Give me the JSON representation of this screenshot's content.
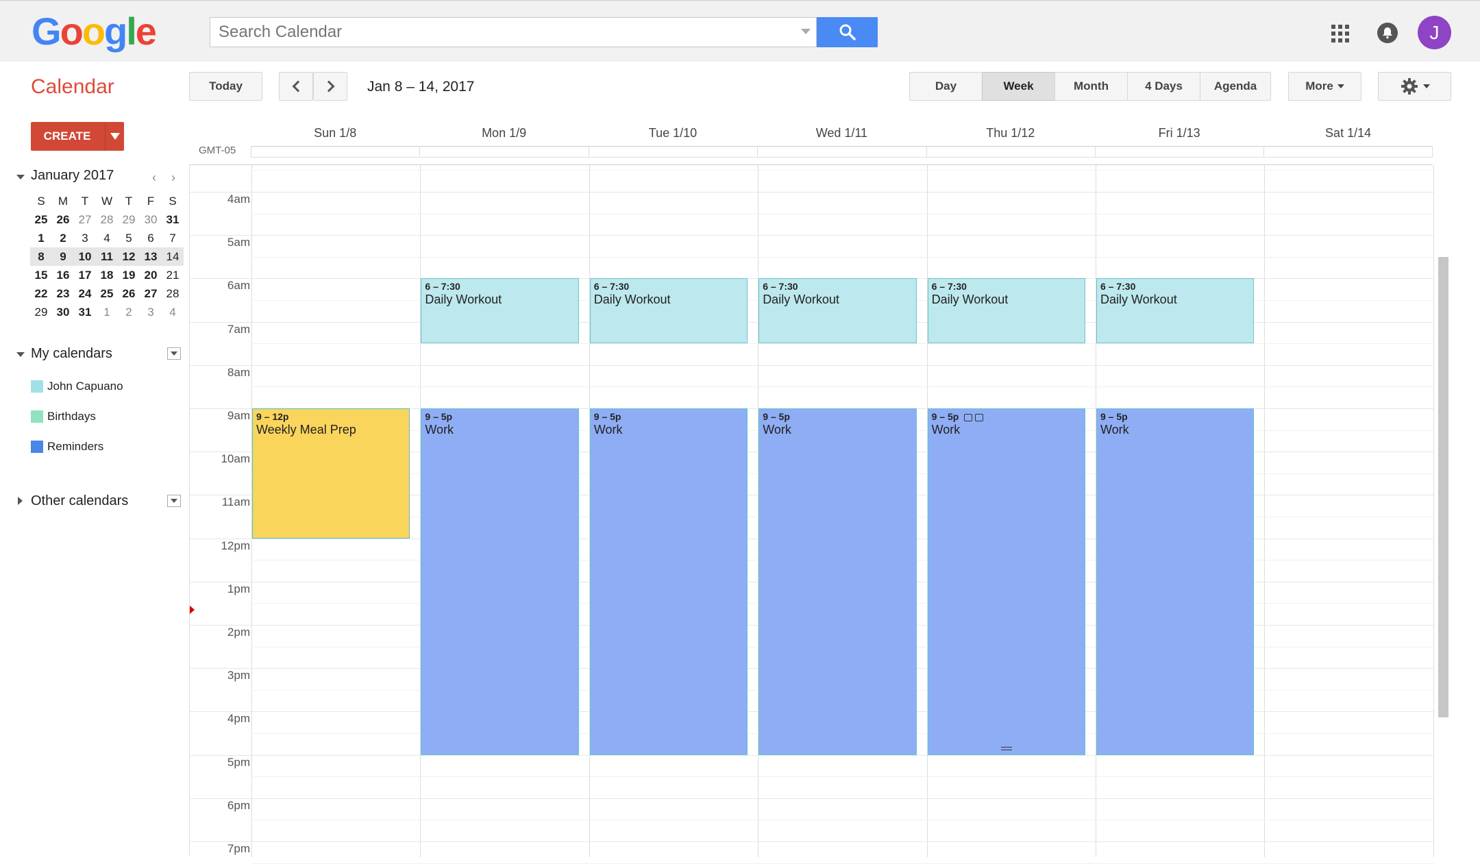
{
  "header": {
    "logo_letters": [
      {
        "ch": "G",
        "color": "#4285f4"
      },
      {
        "ch": "o",
        "color": "#ea4335"
      },
      {
        "ch": "o",
        "color": "#fbbc05"
      },
      {
        "ch": "g",
        "color": "#4285f4"
      },
      {
        "ch": "l",
        "color": "#34a853"
      },
      {
        "ch": "e",
        "color": "#ea4335"
      }
    ],
    "search_placeholder": "Search Calendar",
    "avatar_initial": "J",
    "icons": [
      "search-icon",
      "apps-grid-icon",
      "bell-icon"
    ]
  },
  "toolbar": {
    "app_title": "Calendar",
    "today": "Today",
    "date_range": "Jan 8 – 14, 2017",
    "views": [
      "Day",
      "Week",
      "Month",
      "4 Days",
      "Agenda"
    ],
    "active_view": "Week",
    "more": "More"
  },
  "sidebar": {
    "create": "CREATE",
    "mini_month": "January 2017",
    "weekdays": [
      "S",
      "M",
      "T",
      "W",
      "T",
      "F",
      "S"
    ],
    "weeks": [
      [
        "25",
        "26",
        "27",
        "28",
        "29",
        "30",
        "31"
      ],
      [
        "1",
        "2",
        "3",
        "4",
        "5",
        "6",
        "7"
      ],
      [
        "8",
        "9",
        "10",
        "11",
        "12",
        "13",
        "14"
      ],
      [
        "15",
        "16",
        "17",
        "18",
        "19",
        "20",
        "21"
      ],
      [
        "22",
        "23",
        "24",
        "25",
        "26",
        "27",
        "28"
      ],
      [
        "29",
        "30",
        "31",
        "1",
        "2",
        "3",
        "4"
      ]
    ],
    "my_calendars_label": "My calendars",
    "my_calendars": [
      {
        "name": "John Capuano",
        "color": "#9fe1e7"
      },
      {
        "name": "Birthdays",
        "color": "#92e1c0"
      },
      {
        "name": "Reminders",
        "color": "#4986e7"
      }
    ],
    "other_calendars_label": "Other calendars"
  },
  "grid": {
    "timezone": "GMT-05",
    "days": [
      "Sun 1/8",
      "Mon 1/9",
      "Tue 1/10",
      "Wed 1/11",
      "Thu 1/12",
      "Fri 1/13",
      "Sat 1/14"
    ],
    "hours": [
      "4am",
      "5am",
      "6am",
      "7am",
      "8am",
      "9am",
      "10am",
      "11am",
      "12pm",
      "1pm",
      "2pm",
      "3pm",
      "4pm",
      "5pm",
      "6pm",
      "7pm"
    ],
    "events": [
      {
        "day": 0,
        "time": "9 – 12p",
        "title": "Weekly Meal Prep",
        "start": 9,
        "end": 12,
        "kind": "meal"
      },
      {
        "day": 1,
        "time": "6 – 7:30",
        "title": "Daily Workout",
        "start": 6,
        "end": 7.5,
        "kind": "workout"
      },
      {
        "day": 2,
        "time": "6 – 7:30",
        "title": "Daily Workout",
        "start": 6,
        "end": 7.5,
        "kind": "workout"
      },
      {
        "day": 3,
        "time": "6 – 7:30",
        "title": "Daily Workout",
        "start": 6,
        "end": 7.5,
        "kind": "workout"
      },
      {
        "day": 4,
        "time": "6 – 7:30",
        "title": "Daily Workout",
        "start": 6,
        "end": 7.5,
        "kind": "workout"
      },
      {
        "day": 5,
        "time": "6 – 7:30",
        "title": "Daily Workout",
        "start": 6,
        "end": 7.5,
        "kind": "workout"
      },
      {
        "day": 1,
        "time": "9 – 5p",
        "title": "Work",
        "start": 9,
        "end": 17,
        "kind": "work"
      },
      {
        "day": 2,
        "time": "9 – 5p",
        "title": "Work",
        "start": 9,
        "end": 17,
        "kind": "work"
      },
      {
        "day": 3,
        "time": "9 – 5p",
        "title": "Work",
        "start": 9,
        "end": 17,
        "kind": "work"
      },
      {
        "day": 4,
        "time": "9 – 5p",
        "title": "Work",
        "start": 9,
        "end": 17,
        "kind": "work",
        "icons": true
      },
      {
        "day": 5,
        "time": "9 – 5p",
        "title": "Work",
        "start": 9,
        "end": 17,
        "kind": "work"
      }
    ]
  }
}
